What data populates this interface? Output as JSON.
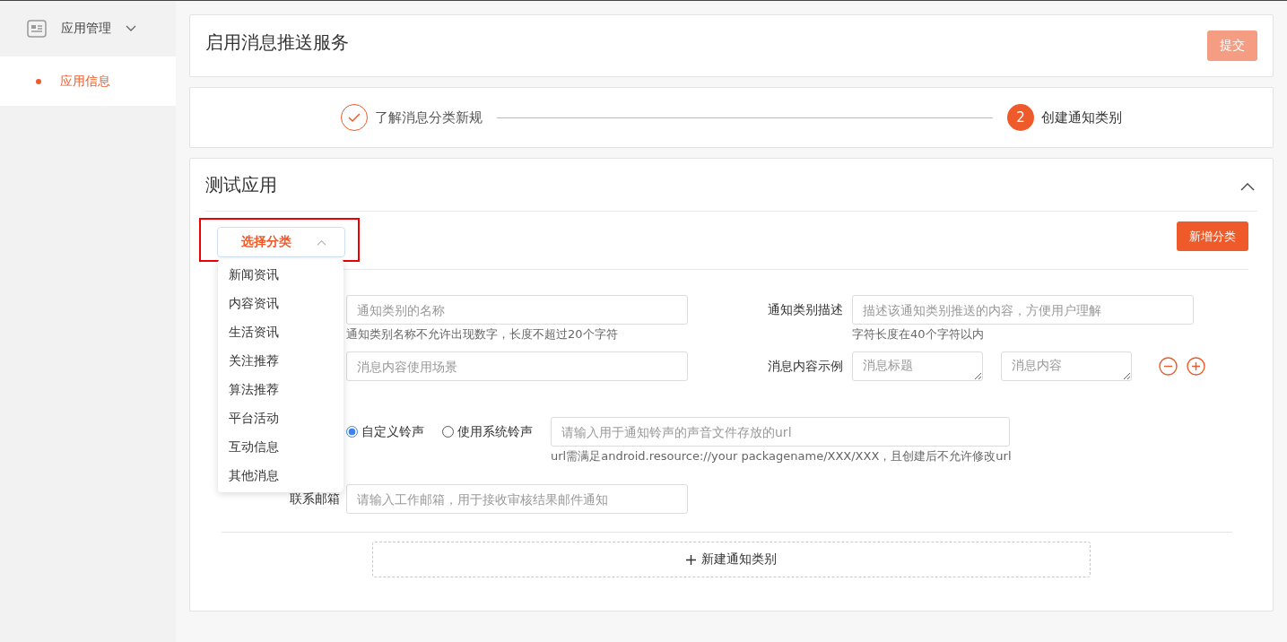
{
  "sidebar": {
    "menu": {
      "label": "应用管理",
      "expanded": true
    },
    "items": [
      {
        "label": "应用信息",
        "selected": true
      }
    ]
  },
  "header": {
    "title": "启用消息推送服务",
    "submit_button": "提交",
    "submit_disabled": true
  },
  "steps": [
    {
      "label": "了解消息分类新规",
      "done": true
    },
    {
      "number": "2",
      "label": "创建通知类别",
      "done": false
    }
  ],
  "app_panel": {
    "title": "测试应用",
    "expanded": true,
    "category_select": {
      "label": "选择分类",
      "open": true,
      "highlighted": true,
      "options": [
        {
          "label": "新闻资讯",
          "selected": false
        },
        {
          "label": "内容资讯",
          "selected": false
        },
        {
          "label": "生活资讯",
          "selected": false
        },
        {
          "label": "关注推荐",
          "selected": false
        },
        {
          "label": "算法推荐",
          "selected": false
        },
        {
          "label": "平台活动",
          "selected": false
        },
        {
          "label": "互动信息",
          "selected": false
        },
        {
          "label": "其他消息",
          "selected": false
        }
      ]
    },
    "add_category_button": "新增分类",
    "form": {
      "name_field": {
        "placeholder": "通知类别的名称",
        "hint": "通知类别名称不允许出现数字，长度不超过20个字符"
      },
      "description_field": {
        "label": "通知类别描述",
        "placeholder": "描述该通知类别推送的内容，方便用户理解",
        "hint": "字符长度在40个字符以内"
      },
      "scene_field": {
        "placeholder": "消息内容使用场景"
      },
      "example": {
        "label": "消息内容示例",
        "title_placeholder": "消息标题",
        "content_placeholder": "消息内容"
      },
      "ringtone": {
        "options": [
          {
            "label": "自定义铃声",
            "selected": true
          },
          {
            "label": "使用系统铃声",
            "selected": false
          }
        ],
        "url_placeholder": "请输入用于通知铃声的声音文件存放的url",
        "hint": "url需满足android.resource://your packagename/XXX/XXX，且创建后不允许修改url"
      },
      "email": {
        "label": "联系邮箱",
        "placeholder": "请输入工作邮箱，用于接收审核结果邮件通知"
      }
    },
    "new_button": "新建通知类别"
  }
}
